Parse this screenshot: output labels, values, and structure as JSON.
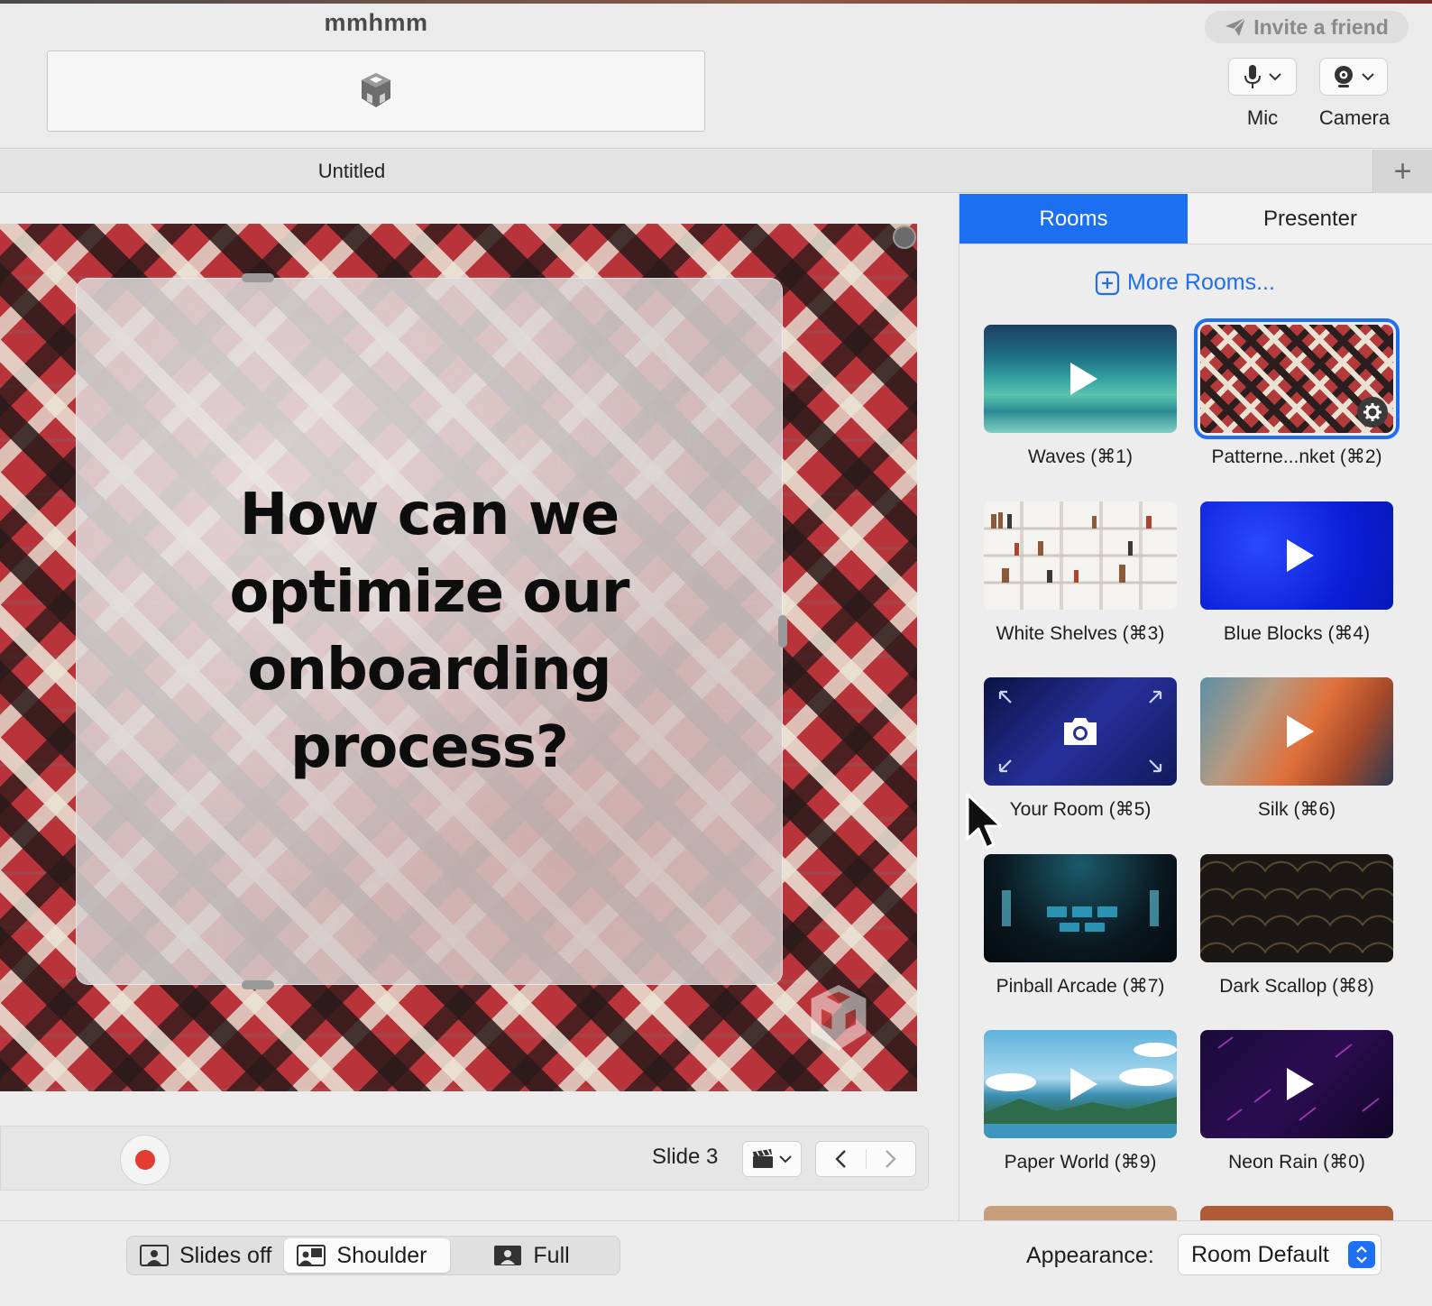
{
  "app": {
    "title": "mmhmm",
    "invite_label": "Invite a friend"
  },
  "devices": {
    "mic_label": "Mic",
    "camera_label": "Camera"
  },
  "tabs": {
    "document_title": "Untitled",
    "add_symbol": "+"
  },
  "slide": {
    "text": "How can we optimize our onboarding process?"
  },
  "controls": {
    "slide_label": "Slide 3"
  },
  "panel": {
    "tabs": [
      "Rooms",
      "Presenter"
    ],
    "more_rooms_label": "More Rooms...",
    "rooms": [
      {
        "label": "Waves (⌘1)"
      },
      {
        "label": "Patterne...nket (⌘2)",
        "selected": true
      },
      {
        "label": "White Shelves (⌘3)"
      },
      {
        "label": "Blue Blocks (⌘4)"
      },
      {
        "label": "Your Room (⌘5)"
      },
      {
        "label": "Silk (⌘6)"
      },
      {
        "label": "Pinball Arcade (⌘7)"
      },
      {
        "label": "Dark Scallop (⌘8)"
      },
      {
        "label": "Paper World (⌘9)"
      },
      {
        "label": "Neon Rain (⌘0)"
      }
    ]
  },
  "bottom": {
    "layouts": [
      "Slides off",
      "Shoulder",
      "Full"
    ],
    "active_layout": "Shoulder",
    "appearance_label": "Appearance:",
    "appearance_value": "Room Default"
  },
  "colors": {
    "accent": "#1f6ff2",
    "record": "#e23b2f",
    "rug_red": "#b8343a"
  }
}
